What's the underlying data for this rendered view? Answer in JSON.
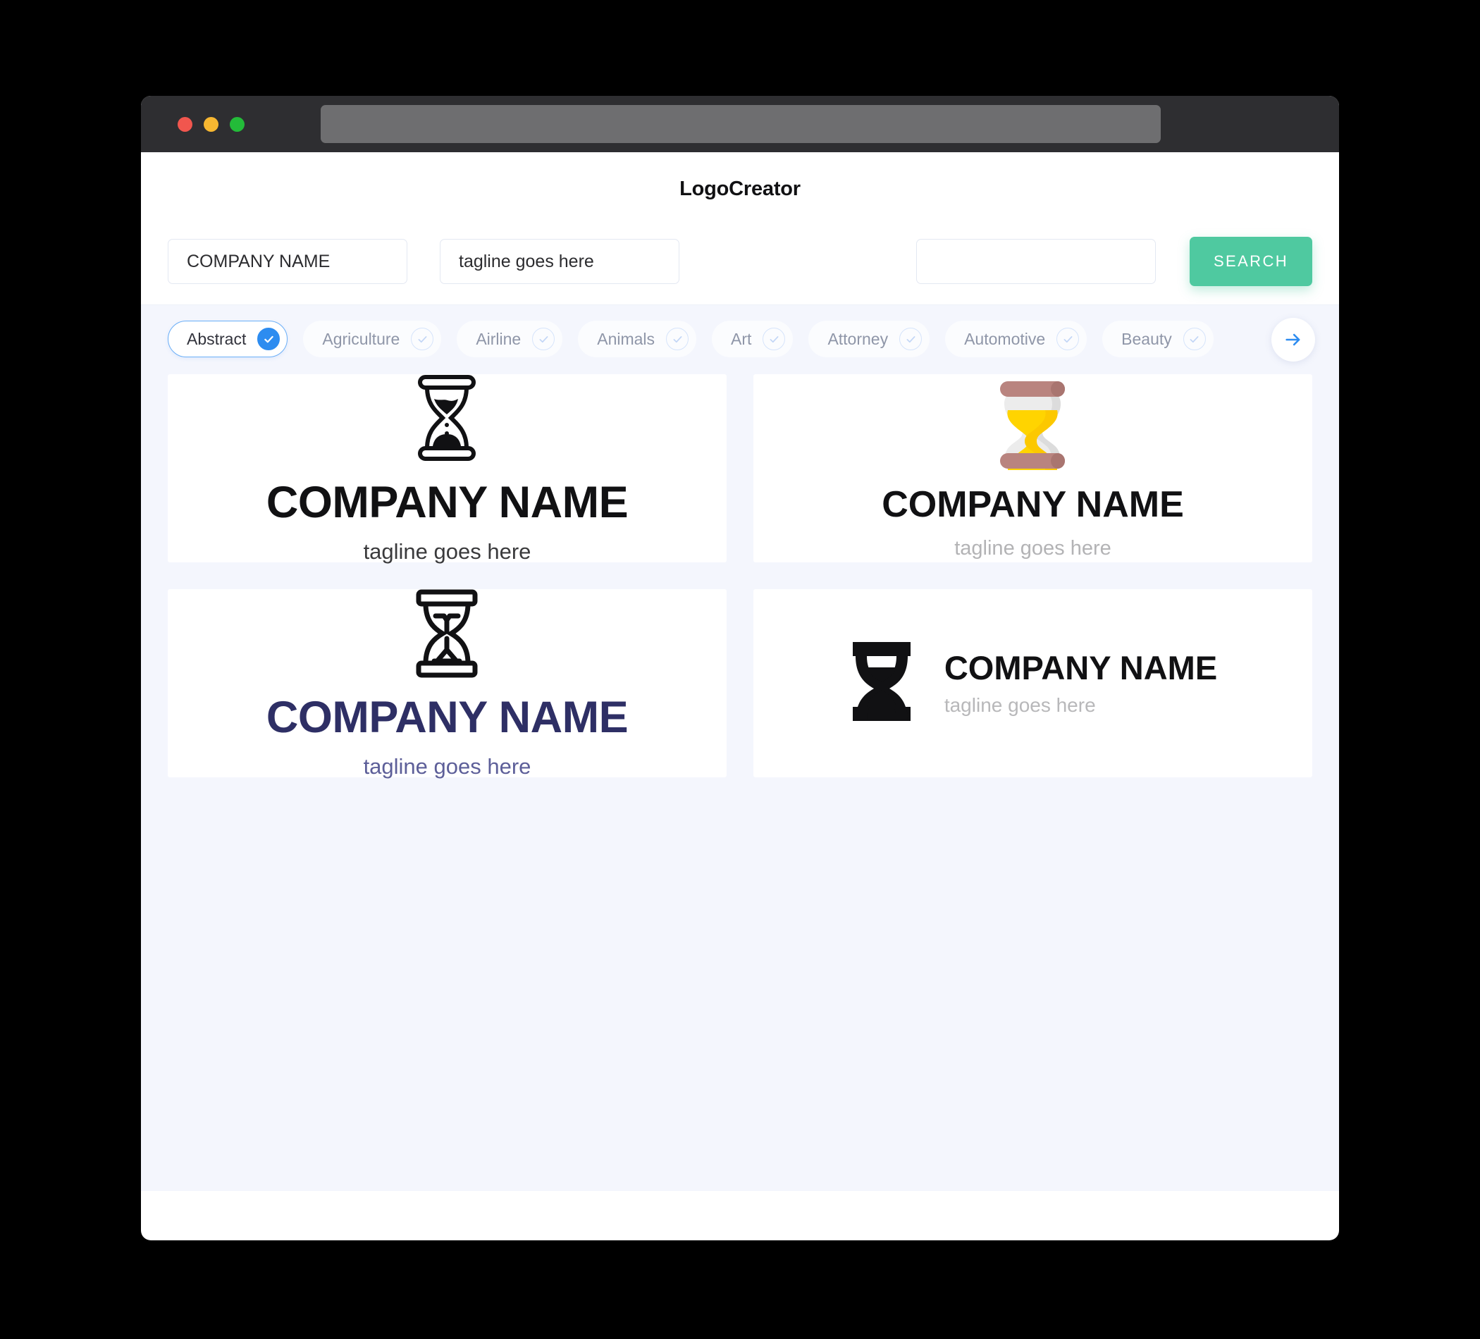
{
  "window": {
    "traffic_lights": [
      {
        "name": "close",
        "color": "#f1564e"
      },
      {
        "name": "minimize",
        "color": "#f7b731"
      },
      {
        "name": "zoom",
        "color": "#23bb39"
      }
    ],
    "url_value": ""
  },
  "header": {
    "app_title": "LogoCreator"
  },
  "search": {
    "company_value": "COMPANY NAME",
    "company_placeholder": "COMPANY NAME",
    "tagline_value": "tagline goes here",
    "tagline_placeholder": "tagline goes here",
    "extra_value": "",
    "extra_placeholder": "",
    "search_label": "SEARCH",
    "search_button_color": "#4fc9a0"
  },
  "categories": {
    "accent_color": "#2d8cf0",
    "next_icon": "arrow-right-icon",
    "items": [
      {
        "label": "Abstract",
        "selected": true
      },
      {
        "label": "Agriculture",
        "selected": false
      },
      {
        "label": "Airline",
        "selected": false
      },
      {
        "label": "Animals",
        "selected": false
      },
      {
        "label": "Art",
        "selected": false
      },
      {
        "label": "Attorney",
        "selected": false
      },
      {
        "label": "Automotive",
        "selected": false
      },
      {
        "label": "Beauty",
        "selected": false
      }
    ]
  },
  "results": {
    "cards": [
      {
        "id": "logo-1",
        "mark": "hourglass-outline-sand-icon",
        "layout": "stacked",
        "name": "COMPANY NAME",
        "tagline": "tagline goes here",
        "name_color": "#111113",
        "tagline_color": "#3a3a3c",
        "mark_color": "#111113"
      },
      {
        "id": "logo-2",
        "mark": "hourglass-flat-color-icon",
        "layout": "stacked",
        "name": "COMPANY NAME",
        "tagline": "tagline goes here",
        "name_color": "#111113",
        "tagline_color": "#b3b3b5",
        "mark_colors": {
          "cap": "#b9847f",
          "cap_shadow": "#a97570",
          "glass": "#ececec",
          "glass_shadow": "#dcdcdc",
          "sand": "#ffd400",
          "sand_shadow": "#fcc800"
        }
      },
      {
        "id": "logo-3",
        "mark": "hourglass-outline-thin-icon",
        "layout": "stacked",
        "name": "COMPANY NAME",
        "tagline": "tagline goes here",
        "name_color": "#2e2f65",
        "tagline_color": "#5d5f99",
        "mark_color": "#111113"
      },
      {
        "id": "logo-4",
        "mark": "hourglass-solid-icon",
        "layout": "horizontal",
        "name": "COMPANY NAME",
        "tagline": "tagline goes here",
        "name_color": "#111113",
        "tagline_color": "#b8b8ba",
        "mark_color": "#111113"
      }
    ]
  },
  "theme": {
    "page_background": "#f4f6fd",
    "card_background": "#ffffff",
    "titlebar_background": "#2e2e31"
  }
}
